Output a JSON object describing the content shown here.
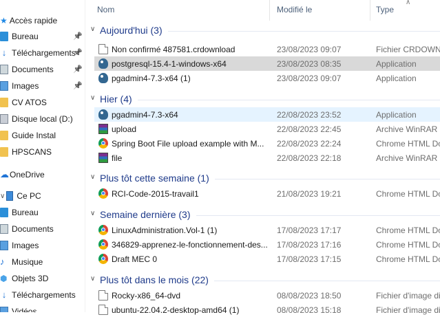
{
  "nav": {
    "quick_access": {
      "label": "Accès rapide"
    },
    "quick_items": [
      {
        "label": "Bureau",
        "pinned": true,
        "icon": "desktop-icon"
      },
      {
        "label": "Téléchargements",
        "pinned": true,
        "icon": "download-icon"
      },
      {
        "label": "Documents",
        "pinned": true,
        "icon": "documents-icon"
      },
      {
        "label": "Images",
        "pinned": true,
        "icon": "images-icon"
      },
      {
        "label": "CV ATOS",
        "pinned": false,
        "icon": "folder-icon"
      },
      {
        "label": "Disque local (D:)",
        "pinned": false,
        "icon": "drive-icon"
      },
      {
        "label": "Guide Instal",
        "pinned": false,
        "icon": "folder-icon"
      },
      {
        "label": "HPSCANS",
        "pinned": false,
        "icon": "folder-icon"
      }
    ],
    "onedrive": {
      "label": "OneDrive"
    },
    "this_pc": {
      "label": "Ce PC"
    },
    "pc_items": [
      {
        "label": "Bureau",
        "icon": "desktop-icon"
      },
      {
        "label": "Documents",
        "icon": "documents-icon"
      },
      {
        "label": "Images",
        "icon": "images-icon"
      },
      {
        "label": "Musique",
        "icon": "music-icon"
      },
      {
        "label": "Objets 3D",
        "icon": "objects-3d-icon"
      },
      {
        "label": "Téléchargements",
        "icon": "download-icon"
      },
      {
        "label": "Vidéos",
        "icon": "videos-icon"
      }
    ]
  },
  "columns": {
    "name": "Nom",
    "modified": "Modifié le",
    "type": "Type"
  },
  "groups": [
    {
      "title": "Aujourd'hui (3)",
      "files": [
        {
          "name": "Non confirmé 487581.crdownload",
          "date": "23/08/2023 09:07",
          "type": "Fichier CRDOWNLOAD",
          "icon": "generic-file-icon"
        },
        {
          "name": "postgresql-15.4-1-windows-x64",
          "date": "23/08/2023 08:35",
          "type": "Application",
          "icon": "postgresql-icon",
          "state": "selected"
        },
        {
          "name": "pgadmin4-7.3-x64 (1)",
          "date": "23/08/2023 09:07",
          "type": "Application",
          "icon": "postgresql-icon"
        }
      ]
    },
    {
      "title": "Hier (4)",
      "files": [
        {
          "name": "pgadmin4-7.3-x64",
          "date": "22/08/2023 23:52",
          "type": "Application",
          "icon": "postgresql-icon",
          "state": "hover"
        },
        {
          "name": "upload",
          "date": "22/08/2023 22:45",
          "type": "Archive WinRAR ZIP",
          "icon": "winrar-icon"
        },
        {
          "name": "Spring Boot File upload example with M...",
          "date": "22/08/2023 22:24",
          "type": "Chrome HTML Document",
          "icon": "chrome-icon"
        },
        {
          "name": "file",
          "date": "22/08/2023 22:18",
          "type": "Archive WinRAR ZIP",
          "icon": "winrar-icon"
        }
      ]
    },
    {
      "title": "Plus tôt cette semaine (1)",
      "files": [
        {
          "name": "RCI-Code-2015-travail1",
          "date": "21/08/2023 19:21",
          "type": "Chrome HTML Document",
          "icon": "chrome-icon"
        }
      ]
    },
    {
      "title": "Semaine dernière (3)",
      "files": [
        {
          "name": "LinuxAdministration.Vol-1 (1)",
          "date": "17/08/2023 17:17",
          "type": "Chrome HTML Document",
          "icon": "chrome-icon"
        },
        {
          "name": "346829-apprenez-le-fonctionnement-des...",
          "date": "17/08/2023 17:16",
          "type": "Chrome HTML Document",
          "icon": "chrome-icon"
        },
        {
          "name": "Draft MEC 0",
          "date": "17/08/2023 17:15",
          "type": "Chrome HTML Document",
          "icon": "chrome-icon"
        }
      ]
    },
    {
      "title": "Plus tôt dans le mois (22)",
      "files": [
        {
          "name": "Rocky-x86_64-dvd",
          "date": "08/08/2023 18:50",
          "type": "Fichier d'image disque",
          "icon": "disc-image-icon"
        },
        {
          "name": "ubuntu-22.04.2-desktop-amd64 (1)",
          "date": "08/08/2023 15:18",
          "type": "Fichier d'image disque",
          "icon": "disc-image-icon"
        }
      ]
    }
  ]
}
